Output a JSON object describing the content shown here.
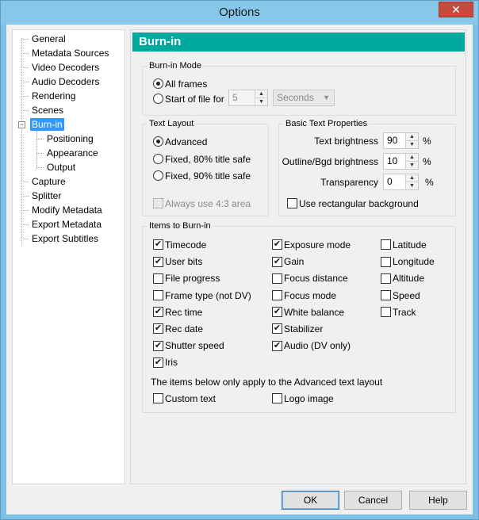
{
  "window": {
    "title": "Options",
    "close_glyph": "✕"
  },
  "tree": {
    "items": [
      {
        "label": "General"
      },
      {
        "label": "Metadata Sources"
      },
      {
        "label": "Video Decoders"
      },
      {
        "label": "Audio Decoders"
      },
      {
        "label": "Rendering"
      },
      {
        "label": "Scenes"
      },
      {
        "label": "Burn-in"
      },
      {
        "label": "Positioning"
      },
      {
        "label": "Appearance"
      },
      {
        "label": "Output"
      },
      {
        "label": "Capture"
      },
      {
        "label": "Splitter"
      },
      {
        "label": "Modify Metadata"
      },
      {
        "label": "Export Metadata"
      },
      {
        "label": "Export Subtitles"
      }
    ],
    "selected": "Burn-in",
    "collapse_glyph": "−"
  },
  "panel": {
    "header": "Burn-in",
    "burnin_mode": {
      "title": "Burn-in Mode",
      "all_frames": "All frames",
      "start_of_file": "Start of file for",
      "start_value": "5",
      "unit_select": "Seconds"
    },
    "text_layout": {
      "title": "Text Layout",
      "advanced": "Advanced",
      "fixed80": "Fixed, 80% title safe",
      "fixed90": "Fixed, 90% title safe",
      "always43": "Always use 4:3 area",
      "selected": "Advanced"
    },
    "basic_text": {
      "title": "Basic Text Properties",
      "text_brightness_label": "Text brightness",
      "text_brightness": "90",
      "outline_label": "Outline/Bgd brightness",
      "outline": "10",
      "transparency_label": "Transparency",
      "transparency": "0",
      "percent": "%",
      "rect_bg": "Use rectangular background"
    },
    "items": {
      "title": "Items to Burn-in",
      "col1": [
        {
          "label": "Timecode",
          "checked": true
        },
        {
          "label": "User bits",
          "checked": true
        },
        {
          "label": "File progress",
          "checked": false
        },
        {
          "label": "Frame type (not DV)",
          "checked": false
        },
        {
          "label": "Rec time",
          "checked": true
        },
        {
          "label": "Rec date",
          "checked": true
        },
        {
          "label": "Shutter speed",
          "checked": true
        },
        {
          "label": "Iris",
          "checked": true
        }
      ],
      "col2": [
        {
          "label": "Exposure mode",
          "checked": true
        },
        {
          "label": "Gain",
          "checked": true
        },
        {
          "label": "Focus distance",
          "checked": false
        },
        {
          "label": "Focus mode",
          "checked": false
        },
        {
          "label": "White balance",
          "checked": true
        },
        {
          "label": "Stabilizer",
          "checked": true
        },
        {
          "label": "Audio (DV only)",
          "checked": true
        }
      ],
      "col3": [
        {
          "label": "Latitude",
          "checked": false
        },
        {
          "label": "Longitude",
          "checked": false
        },
        {
          "label": "Altitude",
          "checked": false
        },
        {
          "label": "Speed",
          "checked": false
        },
        {
          "label": "Track",
          "checked": false
        }
      ],
      "advanced_note": "The items below only apply to the Advanced text layout",
      "custom_text": "Custom text",
      "logo_image": "Logo image"
    }
  },
  "buttons": {
    "ok": "OK",
    "cancel": "Cancel",
    "help": "Help"
  },
  "colors": {
    "header": "#00a99d",
    "selection": "#3399ff",
    "close": "#c74a3c"
  },
  "icons": {
    "check": "✔",
    "spin_up": "▲",
    "spin_down": "▼",
    "combo_caret": "▼"
  }
}
